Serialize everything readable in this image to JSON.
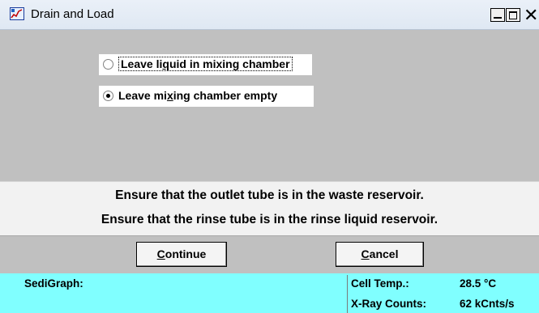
{
  "window": {
    "title": "Drain and Load",
    "close_glyph": "✕"
  },
  "options": [
    {
      "label_before": "Leave li",
      "mnemonic": "q",
      "label_after": "uid in mixing chamber",
      "selected": false
    },
    {
      "label_before": "Leave mi",
      "mnemonic": "x",
      "label_after": "ing chamber empty",
      "selected": true
    }
  ],
  "messages": {
    "line1": "Ensure that the outlet tube is in the waste reservoir.",
    "line2": "Ensure that the rinse tube is in the rinse liquid reservoir."
  },
  "buttons": {
    "continue": {
      "mnemonic": "C",
      "rest": "ontinue"
    },
    "cancel": {
      "mnemonic": "C",
      "rest": "ancel"
    }
  },
  "status": {
    "app_label": "SediGraph:",
    "cell_temp_label": "Cell Temp.:",
    "cell_temp_value": "28.5 °C",
    "xray_label": "X-Ray Counts:",
    "xray_value": "62 kCnts/s"
  },
  "colors": {
    "status_bar": "#80ffff",
    "dialog_bg": "#c0c0c0",
    "message_bg": "#f2f2f2"
  }
}
